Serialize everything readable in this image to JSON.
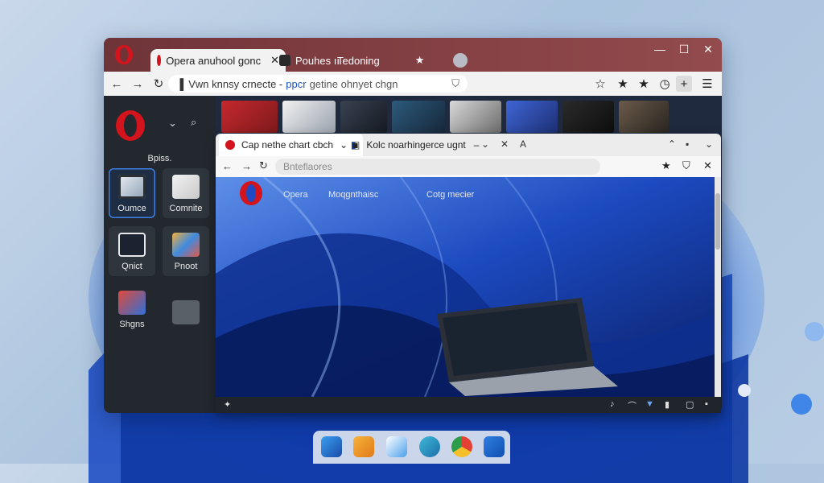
{
  "window": {
    "tabs": [
      {
        "label": "Opera anuhool gonc",
        "active": true
      },
      {
        "label": "Pouhes ıı",
        "active": false
      },
      {
        "label": "Tedoning",
        "active": false
      }
    ],
    "address": {
      "text_main": "Vwn knnsy crnecte -",
      "text_highlight": "ppcr",
      "text_rest": "getine ohnyet chgn"
    }
  },
  "sidebar": {
    "section_label": "Bpiss.",
    "tiles": [
      {
        "label": "Oumce",
        "selected": true
      },
      {
        "label": "Comnite",
        "selected": false
      },
      {
        "label": "Qnict",
        "selected": false
      },
      {
        "label": "Pnoot",
        "selected": false
      },
      {
        "label": "Shgns",
        "selected": false
      },
      {
        "label": "",
        "selected": false
      }
    ]
  },
  "inner_window": {
    "tabs": [
      {
        "label": "Cap nethe chart cbch",
        "active": true
      },
      {
        "label": "Kolc noarhingerce ugnt",
        "active": false
      }
    ],
    "address_placeholder": "Bnteflaores",
    "page_nav": [
      "Opera",
      "Moqgnthaisc",
      "Cotg mecier"
    ]
  },
  "colors": {
    "accent": "#3c7fe0",
    "opera_red": "#d3141c",
    "titlebar": "#7f3d41"
  }
}
